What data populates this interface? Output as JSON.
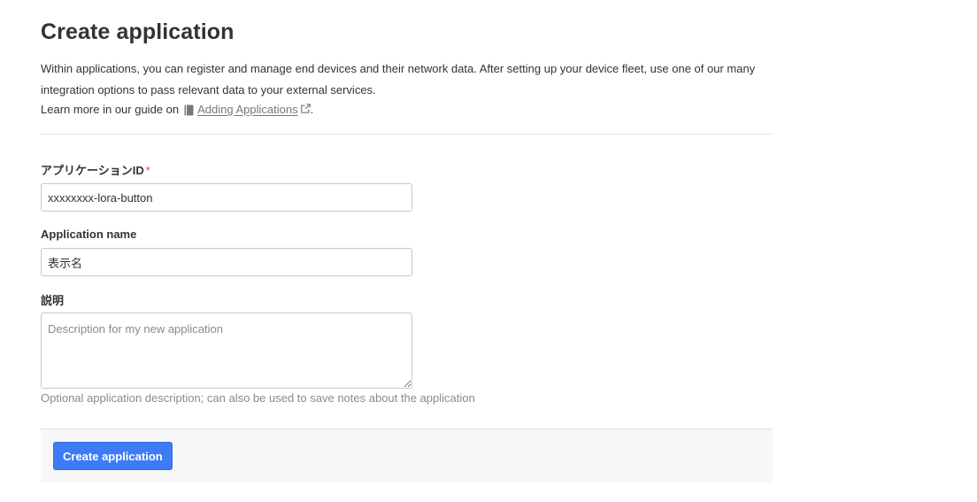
{
  "page": {
    "title": "Create application"
  },
  "intro": {
    "paragraph": "Within applications, you can register and manage end devices and their network data. After setting up your device fleet, use one of our many integration options to pass relevant data to your external services.",
    "guide_prefix": "Learn more in our guide on",
    "guide_link": "Adding Applications",
    "guide_suffix": "."
  },
  "form": {
    "app_id": {
      "label": "アプリケーションID",
      "required_mark": "*",
      "value": "xxxxxxxx-lora-button"
    },
    "app_name": {
      "label": "Application name",
      "value": "表示名"
    },
    "description": {
      "label": "説明",
      "placeholder": "Description for my new application",
      "help": "Optional application description; can also be used to save notes about the application"
    }
  },
  "footer": {
    "submit_label": "Create application"
  },
  "colors": {
    "accent": "#3e7bf7",
    "required": "#e3453b",
    "muted_text": "#8a8a8a"
  },
  "icons": {
    "guide": "book-icon",
    "external": "external-link-icon"
  }
}
